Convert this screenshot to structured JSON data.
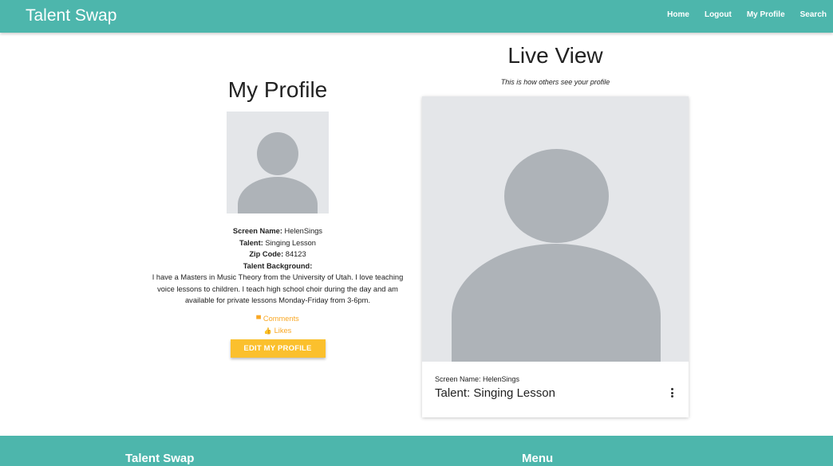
{
  "nav": {
    "brand": "Talent Swap",
    "links": [
      "Home",
      "Logout",
      "My Profile",
      "Search"
    ]
  },
  "profile": {
    "title": "My Profile",
    "screen_name_label": "Screen Name:",
    "screen_name": "HelenSings",
    "talent_label": "Talent:",
    "talent": "Singing Lesson",
    "zip_label": "Zip Code:",
    "zip": "84123",
    "background_label": "Talent Background:",
    "background": "I have a Masters in Music Theory from the University of Utah. I love teaching voice lessons to children. I teach high school choir during the day and am available for private lessons Monday-Friday from 3-6pm.",
    "comments_label": "Comments",
    "likes_label": "Likes",
    "edit_button": "EDIT MY PROFILE"
  },
  "live": {
    "title": "Live View",
    "subtitle": "This is how others see your profile",
    "card_screen_name": "Screen Name: HelenSings",
    "card_talent": "Talent: Singing Lesson"
  },
  "footer": {
    "brand": "Talent Swap",
    "menu": "Menu"
  },
  "colors": {
    "primary": "#4db6ac",
    "accent": "#fbc02d",
    "link": "#f9a825"
  },
  "icons": {
    "comments": "comment-icon",
    "likes": "thumb-up-icon",
    "more": "more-vert-icon",
    "avatar": "person-placeholder-icon"
  }
}
